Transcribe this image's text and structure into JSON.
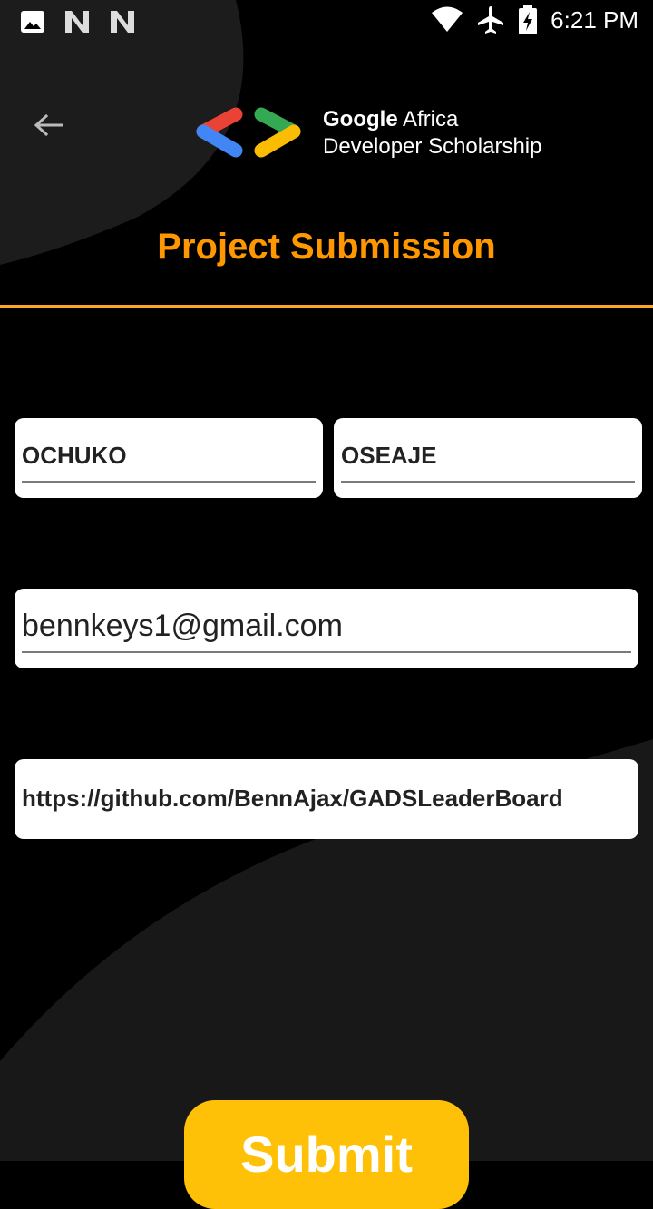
{
  "status_bar": {
    "time": "6:21 PM",
    "left_icons": [
      "image-icon",
      "n-notification-icon",
      "n-notification-icon"
    ],
    "right_icons": [
      "wifi-icon",
      "airplane-mode-icon",
      "battery-charging-icon"
    ]
  },
  "header": {
    "back_icon": "arrow-back-icon",
    "logo_line1_bold": "Google",
    "logo_line1_rest": " Africa",
    "logo_line2": "Developer Scholarship"
  },
  "page": {
    "title": "Project Submission"
  },
  "form": {
    "first_name": "OCHUKO",
    "last_name": "OSEAJE",
    "email": "bennkeys1@gmail.com",
    "github_link": "https://github.com/BennAjax/GADSLeaderBoard",
    "submit_label": "Submit"
  },
  "colors": {
    "background": "#000000",
    "title": "#FF9800",
    "divider": "#F9A825",
    "button": "#FFC107",
    "field": "#FFFFFF"
  }
}
